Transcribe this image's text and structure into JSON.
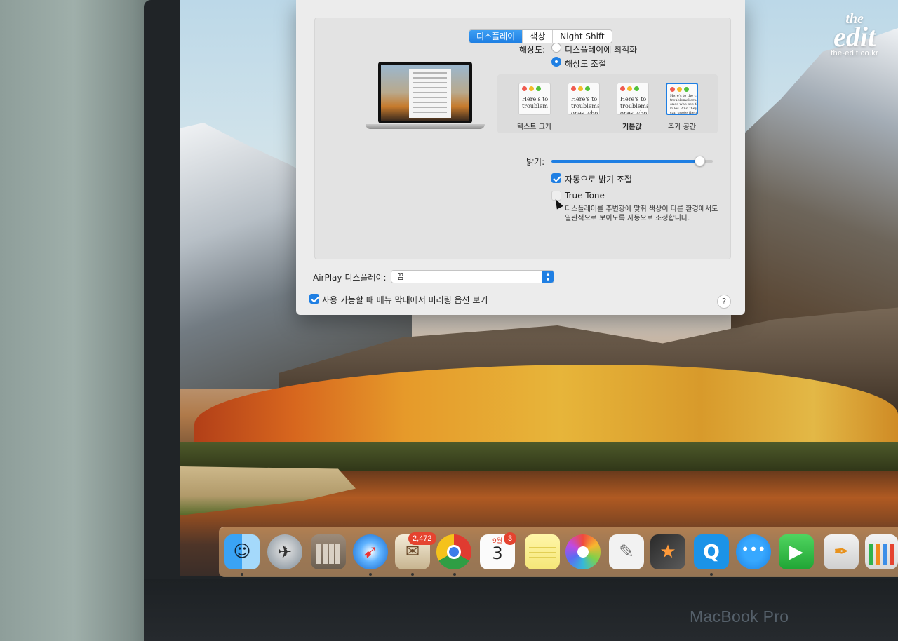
{
  "tabs": [
    {
      "label": "디스플레이",
      "active": true
    },
    {
      "label": "색상",
      "active": false
    },
    {
      "label": "Night Shift",
      "active": false
    }
  ],
  "resolution": {
    "label": "해상도:",
    "options": [
      "디스플레이에 최적화",
      "해상도 조절"
    ],
    "selected": "해상도 조절"
  },
  "scaled_options": [
    {
      "preview": "Here's to\ntroublem",
      "label": "텍스트 크게"
    },
    {
      "preview": "Here's to th\ntroublemak\nones who s",
      "label": ""
    },
    {
      "preview": "Here's to the\ntroublemakers\nones who see t\nrules. And the",
      "label": "기본값"
    },
    {
      "preview": "Here's to the crazy\ntroublemakers. The\nones who see things\nrules. And they have\ncan quote them, di\nthem. About the onl\nthings. They push t\nbecause the ones w",
      "label": "추가 공간",
      "selected": true
    }
  ],
  "brightness": {
    "label": "밝기:",
    "level": 0.92
  },
  "auto_brightness": {
    "label": "자동으로 밝기 조절",
    "checked": true
  },
  "true_tone": {
    "label": "True Tone",
    "checked": false,
    "description_line1": "디스플레이를 주변광에 맞춰 색상이 다른 환경에서도",
    "description_line2": "일관적으로 보이도록 자동으로 조정합니다."
  },
  "airplay": {
    "label": "AirPlay 디스플레이:",
    "value": "끔"
  },
  "mirroring": {
    "label": "사용 가능할 때 메뉴 막대에서 미러링 옵션 보기",
    "checked": true
  },
  "help_label": "?",
  "dock": {
    "mail_badge": "2,472",
    "calendar_badge": "3",
    "calendar_month": "9월",
    "calendar_day": "3"
  },
  "device_label": "MacBook Pro",
  "watermark": {
    "title": "the",
    "name": "edit",
    "url": "the-edit.co.kr"
  },
  "colors": {
    "accent": "#1f7fe3",
    "badge": "#e5432f",
    "window": "#ececec"
  }
}
